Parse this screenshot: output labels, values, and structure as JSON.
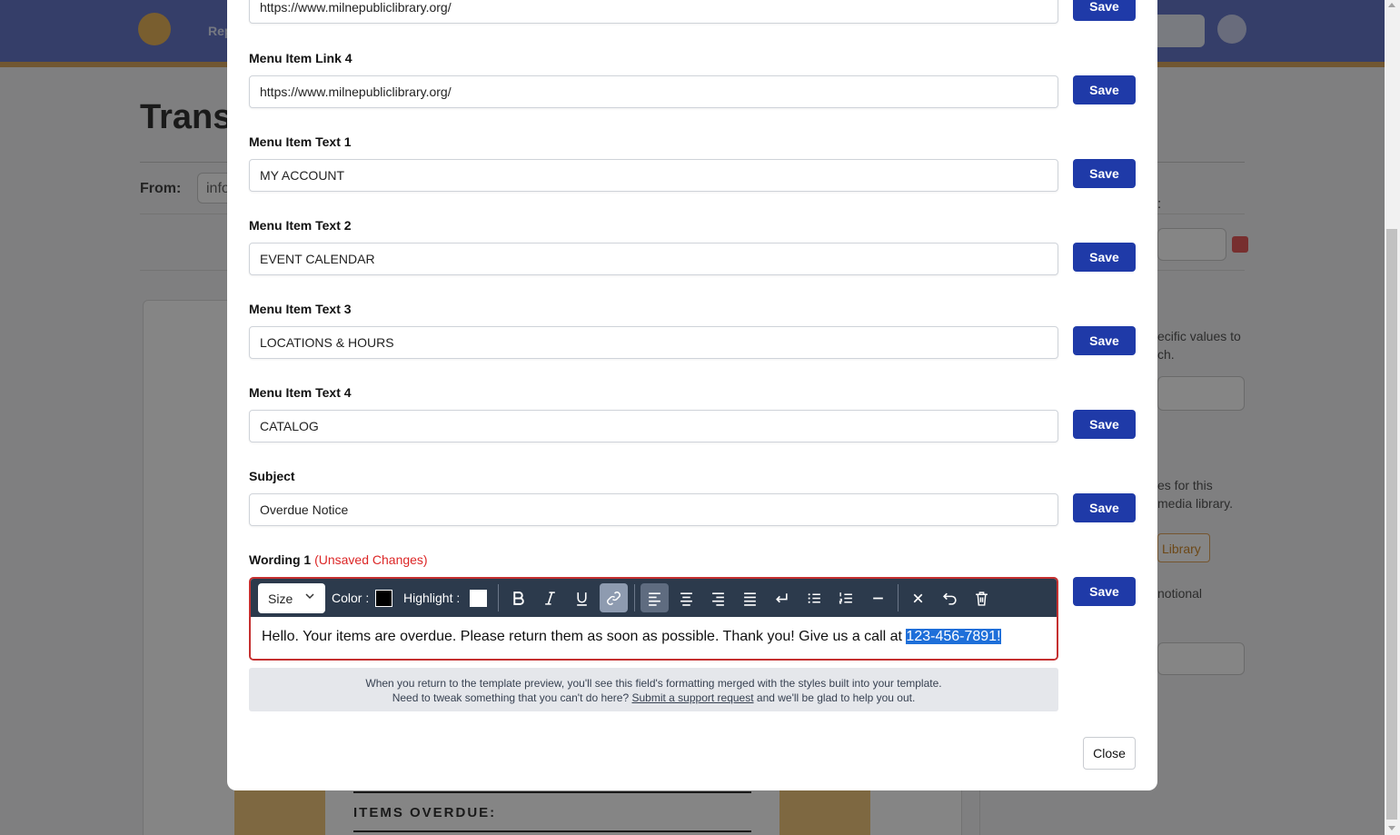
{
  "background": {
    "nav_text": "Rep",
    "page_title": "Transa",
    "from_label": "From:",
    "from_value": "info",
    "colon": ":",
    "right_text_1": [
      "ecific values to",
      "ch."
    ],
    "right_text_2": [
      "es for this",
      "media library."
    ],
    "library_button": "Library",
    "right_text_3": "notional",
    "items_overdue": "ITEMS OVERDUE:"
  },
  "modal": {
    "fields": [
      {
        "label": "",
        "value": "https://www.milnepubliclibrary.org/",
        "save_label": "Save"
      },
      {
        "label": "Menu Item Link 4",
        "value": "https://www.milnepubliclibrary.org/",
        "save_label": "Save"
      },
      {
        "label": "Menu Item Text 1",
        "value": "MY ACCOUNT",
        "save_label": "Save"
      },
      {
        "label": "Menu Item Text 2",
        "value": "EVENT CALENDAR",
        "save_label": "Save"
      },
      {
        "label": "Menu Item Text 3",
        "value": "LOCATIONS & HOURS",
        "save_label": "Save"
      },
      {
        "label": "Menu Item Text 4",
        "value": "CATALOG",
        "save_label": "Save"
      },
      {
        "label": "Subject",
        "value": "Overdue Notice",
        "save_label": "Save"
      }
    ],
    "wording": {
      "label": "Wording 1",
      "unsaved": "(Unsaved Changes)",
      "save_label": "Save",
      "toolbar": {
        "size_label": "Size",
        "color_label": "Color :",
        "color_value": "#000000",
        "highlight_label": "Highlight :",
        "highlight_value": "#ffffff"
      },
      "body_text": "Hello. Your items are overdue. Please return them as soon as possible. Thank you! Give us a call at ",
      "selected_text": "123-456-7891!"
    },
    "help": {
      "line1": "When you return to the template preview, you'll see this field's formatting merged with the styles built into your template.",
      "line2_prefix": "Need to tweak something that you can't do here? ",
      "line2_link": "Submit a support request",
      "line2_suffix": " and we'll be glad to help you out."
    },
    "close_label": "Close"
  },
  "colors": {
    "primary_button": "#1f3aa8",
    "toolbar_bg": "#2c3a4c",
    "error_red": "#dc2626",
    "selection": "#1e6fd9"
  }
}
